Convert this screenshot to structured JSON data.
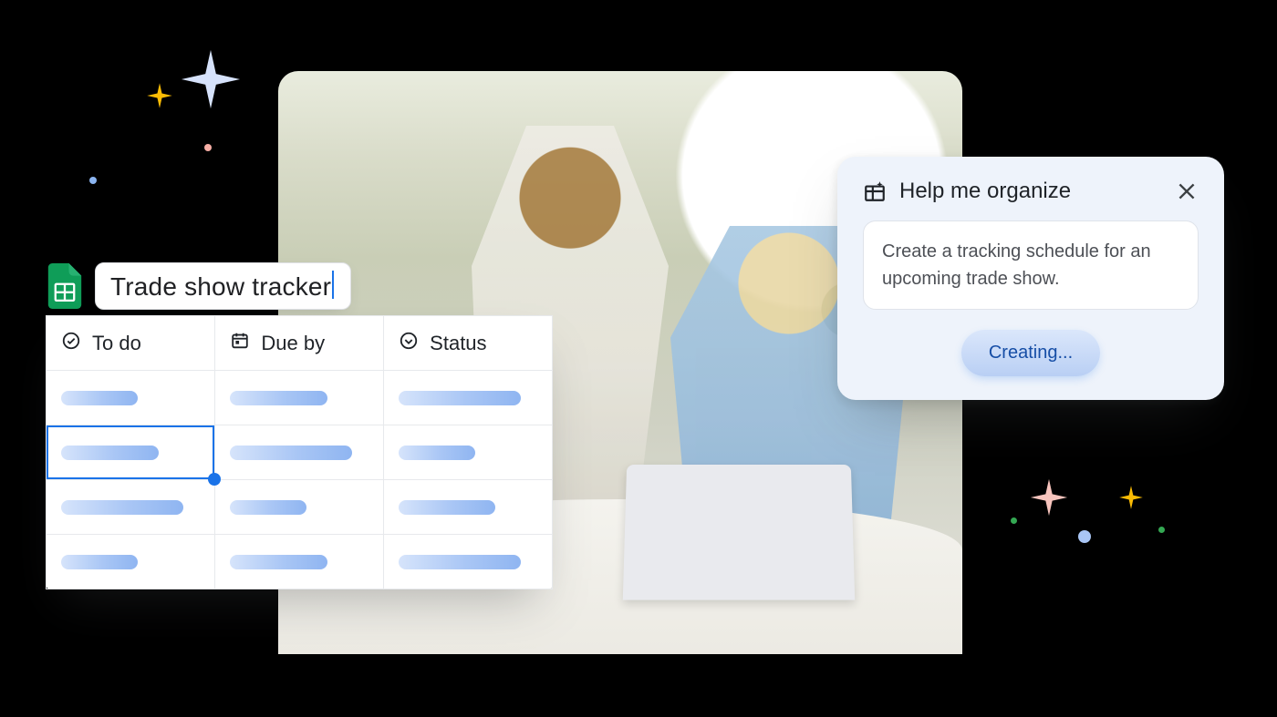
{
  "doc": {
    "title": "Trade show tracker"
  },
  "table": {
    "columns": [
      {
        "label": "To do",
        "icon": "check-circle"
      },
      {
        "label": "Due by",
        "icon": "calendar"
      },
      {
        "label": "Status",
        "icon": "chevron-circle"
      }
    ],
    "row_count": 4,
    "selected_row": 1,
    "selected_col": 0
  },
  "panel": {
    "title": "Help me organize",
    "prompt": "Create a tracking schedule for an upcoming trade show.",
    "action_label": "Creating..."
  },
  "colors": {
    "accent": "#1a73e8",
    "sheets_green": "#0f9d58"
  }
}
